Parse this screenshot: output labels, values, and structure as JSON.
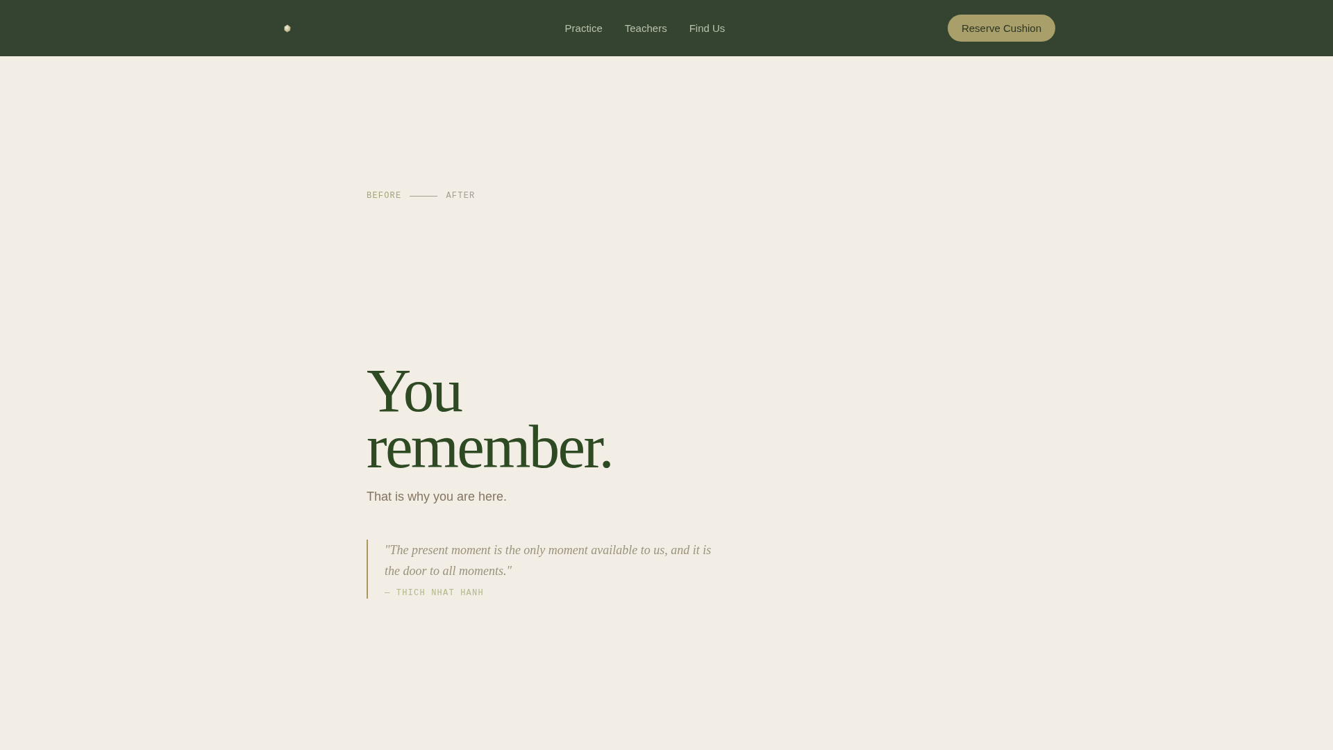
{
  "header": {
    "nav": [
      "Practice",
      "Teachers",
      "Find Us"
    ],
    "cta": "Reserve Cushion"
  },
  "hero": {
    "stages": [
      {
        "label": "BEFORE",
        "selected": true
      },
      {
        "label": "AFTER",
        "selected": false
      }
    ],
    "heading": "You remember.",
    "subtitle": "That is why you are here.",
    "quote": {
      "text": "\"The present moment is the only moment available to us, and it is the door to all moments.\"",
      "attribution": "— THICH NHAT HANH"
    }
  }
}
